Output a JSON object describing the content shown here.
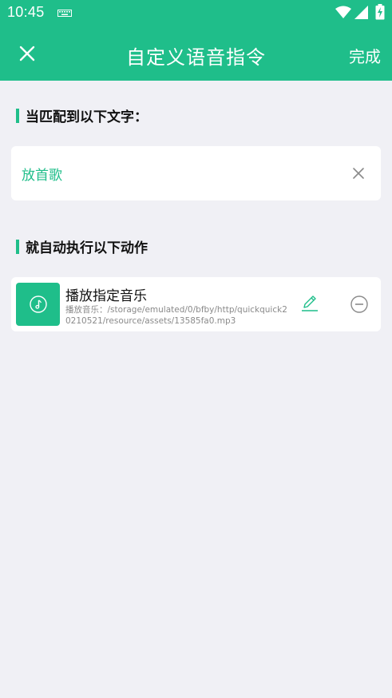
{
  "status_bar": {
    "time": "10:45",
    "icons": [
      "keyboard-icon",
      "wifi-icon",
      "signal-icon",
      "battery-icon"
    ]
  },
  "app_bar": {
    "title": "自定义语音指令",
    "close_icon": "close-icon",
    "done_label": "完成"
  },
  "trigger_section": {
    "header": "当匹配到以下文字：",
    "phrase": "放首歌",
    "clear_icon": "clear-icon"
  },
  "action_section": {
    "header": "就自动执行以下动作",
    "actions": [
      {
        "icon": "music-note-icon",
        "title": "播放指定音乐",
        "description": "播放音乐：/storage/emulated/0/bfby/http/quickquick20210521/resource/assets/13585fa0.mp3",
        "edit_icon": "edit-icon",
        "remove_icon": "remove-icon"
      }
    ]
  },
  "colors": {
    "accent": "#1fbe8a",
    "background": "#f0f0f5",
    "card": "#ffffff",
    "text_primary": "#111111",
    "text_secondary": "#8a8a8a"
  }
}
